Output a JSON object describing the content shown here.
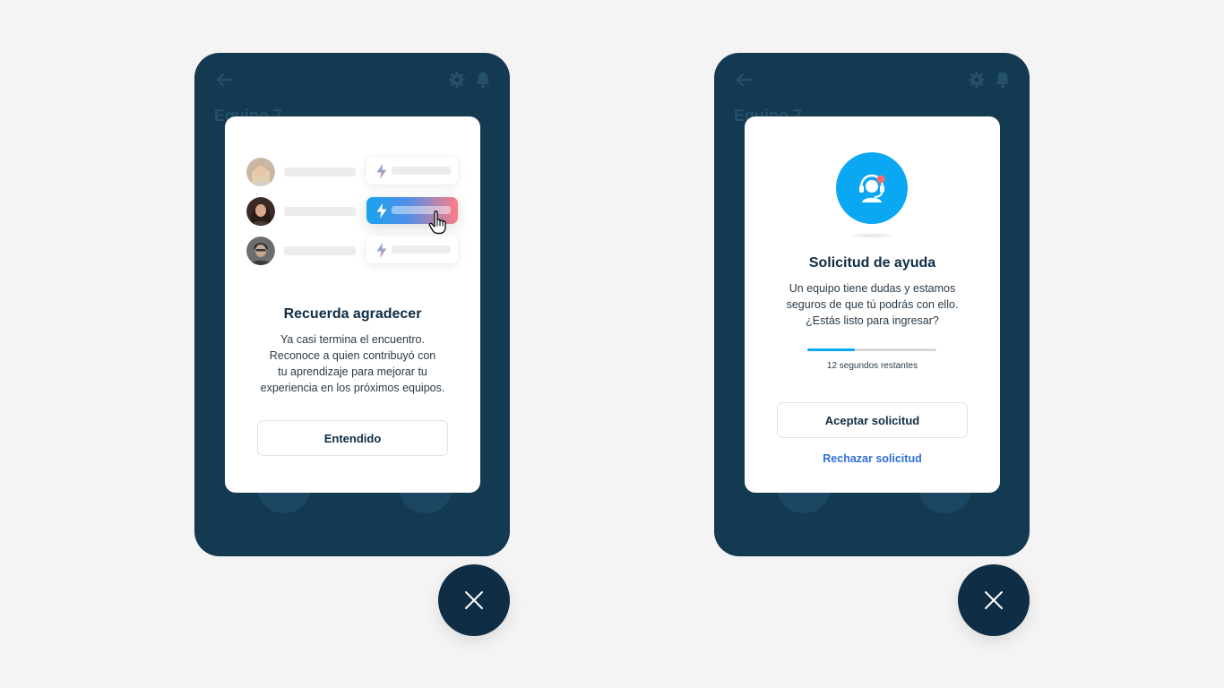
{
  "background_title": "Equipo 7",
  "recognition_modal": {
    "title": "Recuerda agradecer",
    "body_lines": [
      "Ya casi termina el encuentro.",
      "Reconoce a quien contribuyó con",
      "tu aprendizaje para mejorar tu",
      "experiencia en los próximos equipos."
    ],
    "button_label": "Entendido"
  },
  "help_modal": {
    "title": "Solicitud de ayuda",
    "body_lines": [
      "Un equipo tiene dudas y estamos",
      "seguros de que tú podrás con ello.",
      "¿Estás listo para ingresar?"
    ],
    "progress_fraction": 0.37,
    "countdown_label": "12 segundos restantes",
    "accept_label": "Aceptar solicitud",
    "reject_label": "Rechazar solicitud"
  },
  "colors": {
    "phone_bg": "#143a52",
    "accent_blue": "#0aa7f2",
    "link_blue": "#2f6fd8",
    "fab_bg": "#0f2d44",
    "notification_dot": "#ff6b6b"
  },
  "icons": {
    "back": "arrow-left-icon",
    "settings": "gear-icon",
    "notifications": "bell-icon",
    "lightning": "bolt-icon",
    "cursor": "hand-pointer-icon",
    "help": "headset-support-icon",
    "close": "close-icon"
  }
}
